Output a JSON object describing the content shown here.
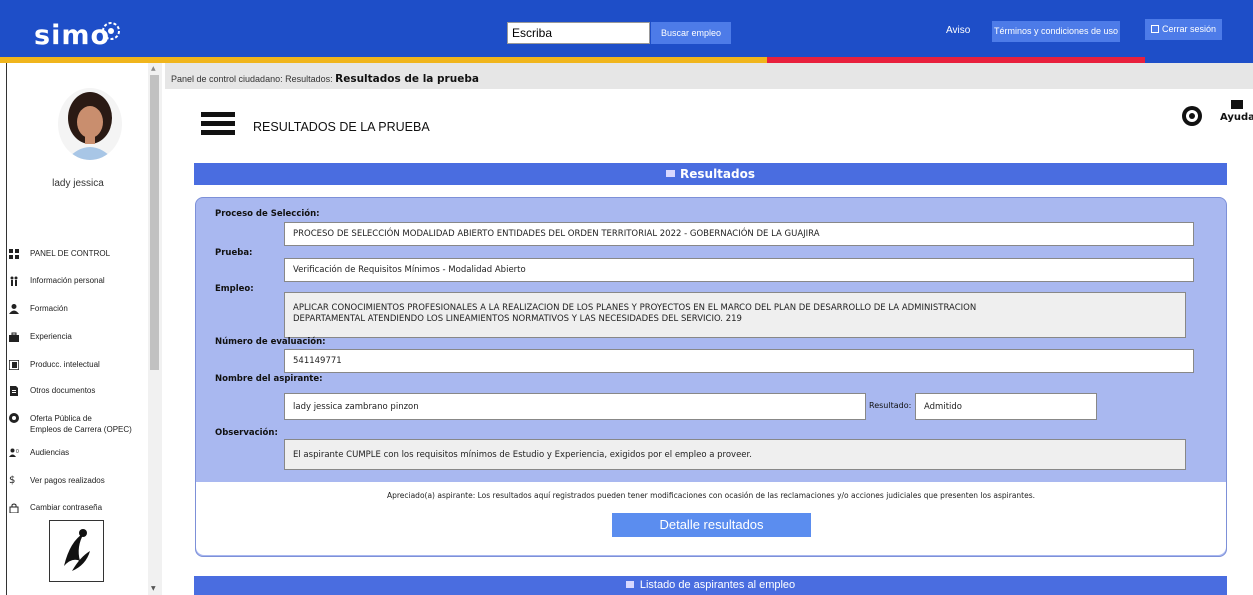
{
  "header": {
    "logo": "SIMO",
    "search_value": "Escriba",
    "search_button": "Buscar empleo",
    "aviso": "Aviso",
    "terms": "Términos y condiciones de uso",
    "logout": "Cerrar sesión"
  },
  "sidebar": {
    "username": "lady jessica",
    "items": [
      {
        "label": "PANEL DE CONTROL",
        "icon": "dashboard-icon"
      },
      {
        "label": "Información personal",
        "icon": "people-icon"
      },
      {
        "label": "Formación",
        "icon": "graduation-icon"
      },
      {
        "label": "Experiencia",
        "icon": "briefcase-icon"
      },
      {
        "label": "Producc. intelectual",
        "icon": "book-icon"
      },
      {
        "label": "Otros documentos",
        "icon": "document-icon"
      },
      {
        "label": "Oferta Pública de",
        "label2": "Empleos de Carrera (OPEC)",
        "icon": "globe-icon"
      },
      {
        "label": "Audiencias",
        "icon": "audience-icon"
      },
      {
        "label": "Ver pagos realizados",
        "icon": "dollar-icon"
      },
      {
        "label": "Cambiar contraseña",
        "icon": "lock-icon"
      }
    ]
  },
  "breadcrumb": {
    "prefix": "Panel de control ciudadano: Resultados:",
    "current": "Resultados de la prueba"
  },
  "page": {
    "title": "RESULTADOS DE LA PRUEBA",
    "help_label": "Ayuda"
  },
  "results": {
    "header": "Resultados",
    "proceso_label": "Proceso de Selección:",
    "proceso_value": "PROCESO DE SELECCIÓN MODALIDAD ABIERTO ENTIDADES DEL ORDEN TERRITORIAL 2022 - GOBERNACIÓN DE LA GUAJIRA",
    "prueba_label": "Prueba:",
    "prueba_value": "Verificación de Requisitos Mínimos - Modalidad Abierto",
    "empleo_label": "Empleo:",
    "empleo_value_line1": "APLICAR CONOCIMIENTOS PROFESIONALES A LA REALIZACION DE LOS PLANES Y PROYECTOS EN EL MARCO DEL PLAN DE DESARROLLO DE LA ADMINISTRACION",
    "empleo_value_line2": "DEPARTAMENTAL ATENDIENDO LOS LINEAMIENTOS NORMATIVOS Y LAS NECESIDADES DEL SERVICIO. 219",
    "numero_label": "Número de evaluación:",
    "numero_value": "541149771",
    "nombre_label": "Nombre del aspirante:",
    "nombre_value": "lady jessica zambrano pinzon",
    "resultado_label": "Resultado:",
    "resultado_value": "Admitido",
    "observacion_label": "Observación:",
    "observacion_value": "El aspirante CUMPLE con los requisitos mínimos de Estudio y Experiencia, exigidos por el empleo a proveer.",
    "notice": "Apreciado(a) aspirante: Los resultados aquí registrados pueden tener modificaciones con ocasión de las reclamaciones y/o acciones judiciales que presenten los aspirantes.",
    "detail_button": "Detalle resultados"
  },
  "list": {
    "header": "Listado de aspirantes al empleo"
  },
  "colors": {
    "primary": "#1e4ec8",
    "accent_yellow": "#f0b51c",
    "accent_red": "#e8203d",
    "panel": "#a9b8f0"
  }
}
